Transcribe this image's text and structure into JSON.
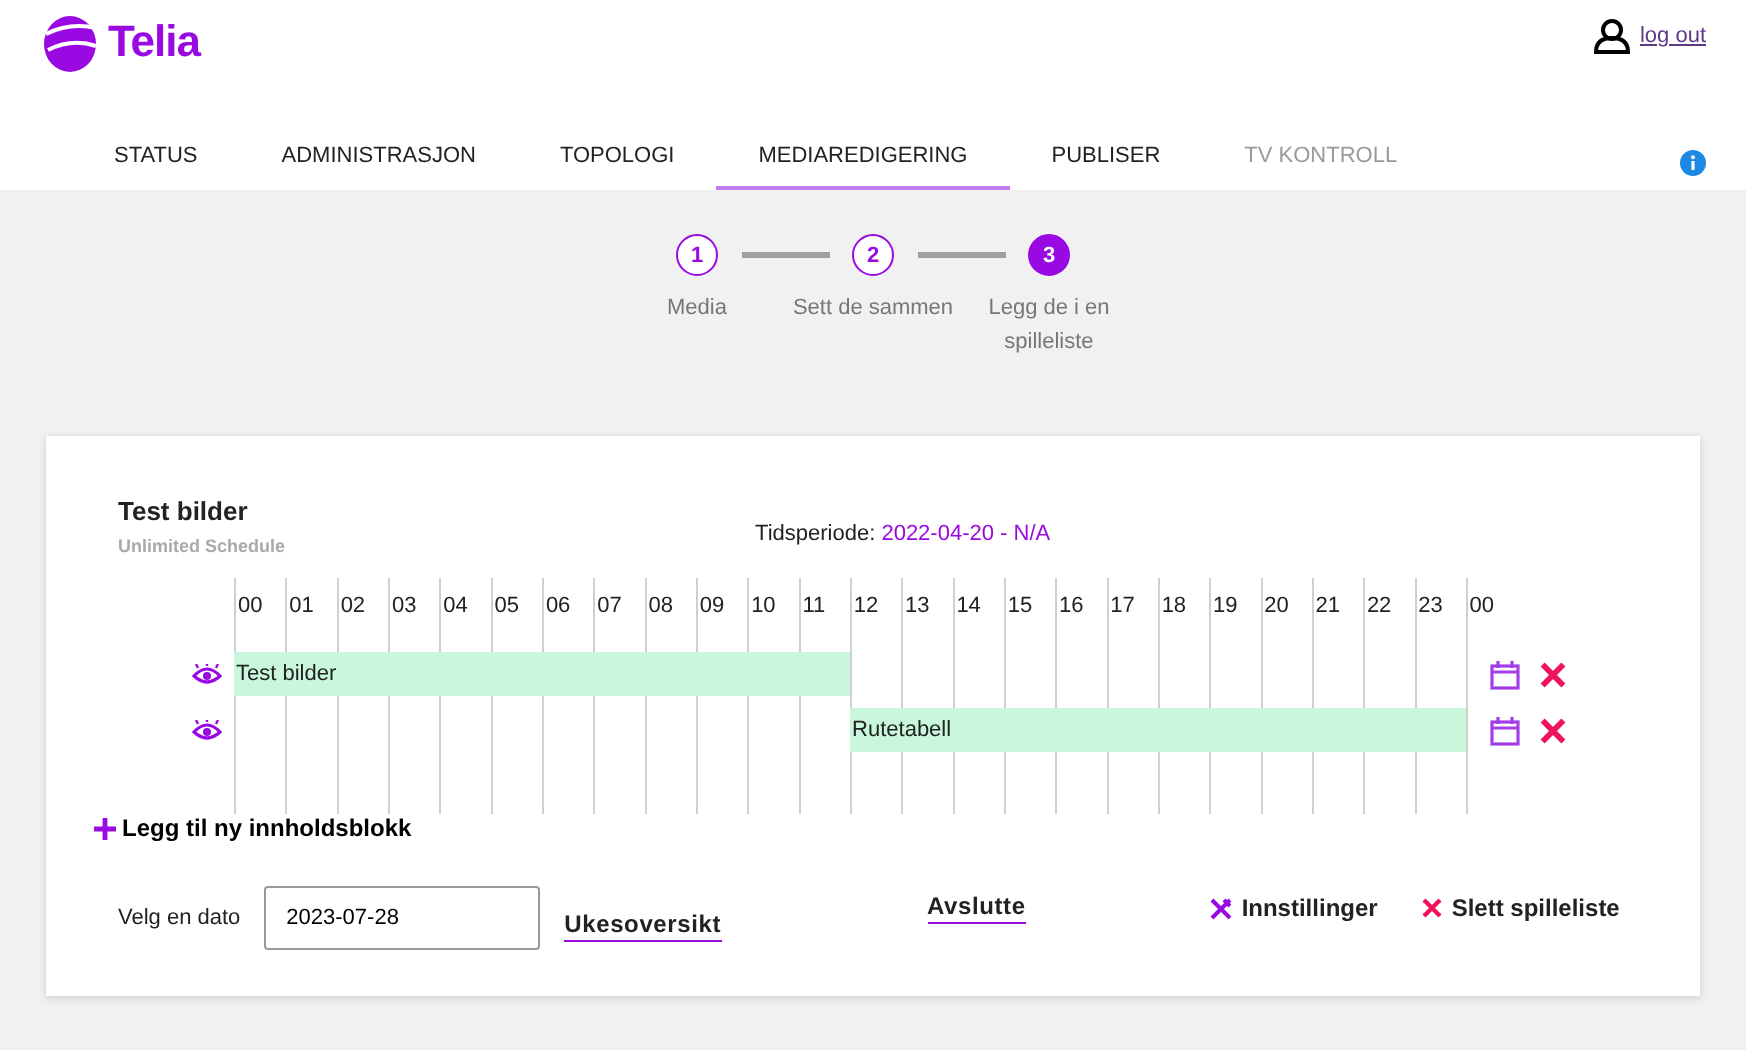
{
  "header": {
    "brand": "Telia",
    "logout": "log out"
  },
  "tabs": [
    {
      "label": "STATUS",
      "selected": false,
      "disabled": false
    },
    {
      "label": "ADMINISTRASJON",
      "selected": false,
      "disabled": false
    },
    {
      "label": "TOPOLOGI",
      "selected": false,
      "disabled": false
    },
    {
      "label": "MEDIAREDIGERING",
      "selected": true,
      "disabled": false
    },
    {
      "label": "PUBLISER",
      "selected": false,
      "disabled": false
    },
    {
      "label": "TV KONTROLL",
      "selected": false,
      "disabled": true
    }
  ],
  "steps": [
    {
      "number": "1",
      "label": "Media",
      "selected": false
    },
    {
      "number": "2",
      "label": "Sett de sammen",
      "selected": false
    },
    {
      "number": "3",
      "label": "Legg de i en spilleliste",
      "selected": true
    }
  ],
  "playlist": {
    "title": "Test bilder",
    "subtitle": "Unlimited Schedule",
    "period_label": "Tidsperiode:",
    "period_value": "2022-04-20 - N/A",
    "hours": [
      "00",
      "01",
      "02",
      "03",
      "04",
      "05",
      "06",
      "07",
      "08",
      "09",
      "10",
      "11",
      "12",
      "13",
      "14",
      "15",
      "16",
      "17",
      "18",
      "19",
      "20",
      "21",
      "22",
      "23",
      "00"
    ],
    "blocks": [
      {
        "label": "Test bilder",
        "level": 0.5
      },
      {
        "label": "Rutetabell",
        "level": 0.5
      }
    ],
    "add_block": "Legg til ny innholdsblokk",
    "date_label": "Velg en dato",
    "date_value": "2023-07-28",
    "week_link": "Ukesoversikt",
    "finish": "Avslutte",
    "settings": "Innstillinger",
    "delete": "Slett spilleliste"
  }
}
